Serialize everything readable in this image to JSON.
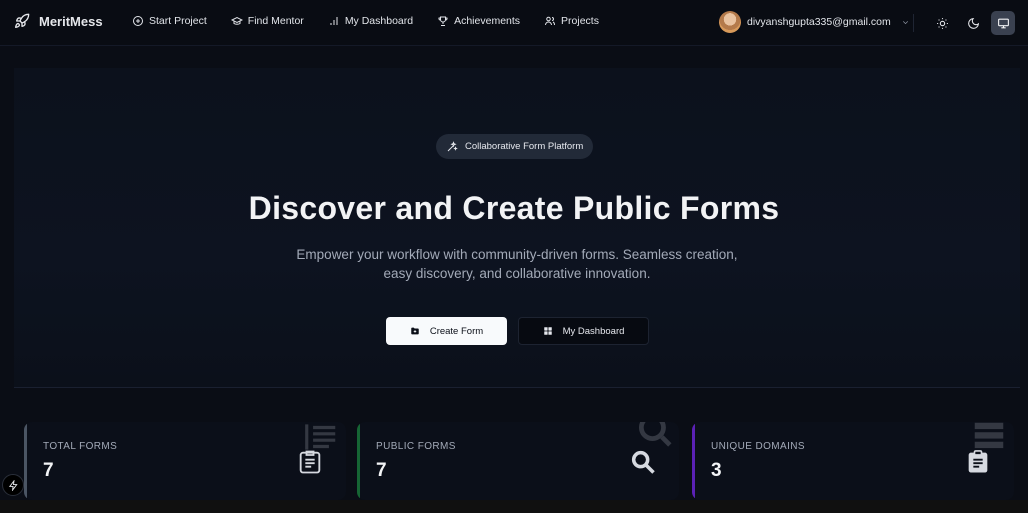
{
  "brand": {
    "name": "MeritMess",
    "icon": "rocket-icon"
  },
  "nav": {
    "items": [
      {
        "label": "Start Project",
        "icon": "plus-circle-icon"
      },
      {
        "label": "Find Mentor",
        "icon": "graduation-cap-icon"
      },
      {
        "label": "My Dashboard",
        "icon": "bar-chart-icon"
      },
      {
        "label": "Achievements",
        "icon": "trophy-icon"
      },
      {
        "label": "Projects",
        "icon": "users-icon"
      }
    ]
  },
  "user": {
    "email": "divyanshgupta335@gmail.com"
  },
  "theme": {
    "active": "system",
    "options": [
      "light",
      "dark",
      "system"
    ]
  },
  "hero": {
    "badge": "Collaborative Form Platform",
    "title": "Discover and Create Public Forms",
    "subtitle_line1": "Empower your workflow with community-driven forms. Seamless creation,",
    "subtitle_line2": "easy discovery, and collaborative innovation.",
    "primary_button": "Create Form",
    "secondary_button": "My Dashboard"
  },
  "stats": [
    {
      "label": "TOTAL FORMS",
      "value": "7",
      "icon": "clipboard-list-icon",
      "accent": "#4b5563"
    },
    {
      "label": "PUBLIC FORMS",
      "value": "7",
      "icon": "search-icon",
      "accent": "#166534"
    },
    {
      "label": "UNIQUE DOMAINS",
      "value": "3",
      "icon": "clipboard-check-icon",
      "accent": "#5b21b6"
    }
  ],
  "colors": {
    "background": "#0a0d15",
    "primary_button_bg": "#f8fafc",
    "pill_bg": "#222a38"
  }
}
